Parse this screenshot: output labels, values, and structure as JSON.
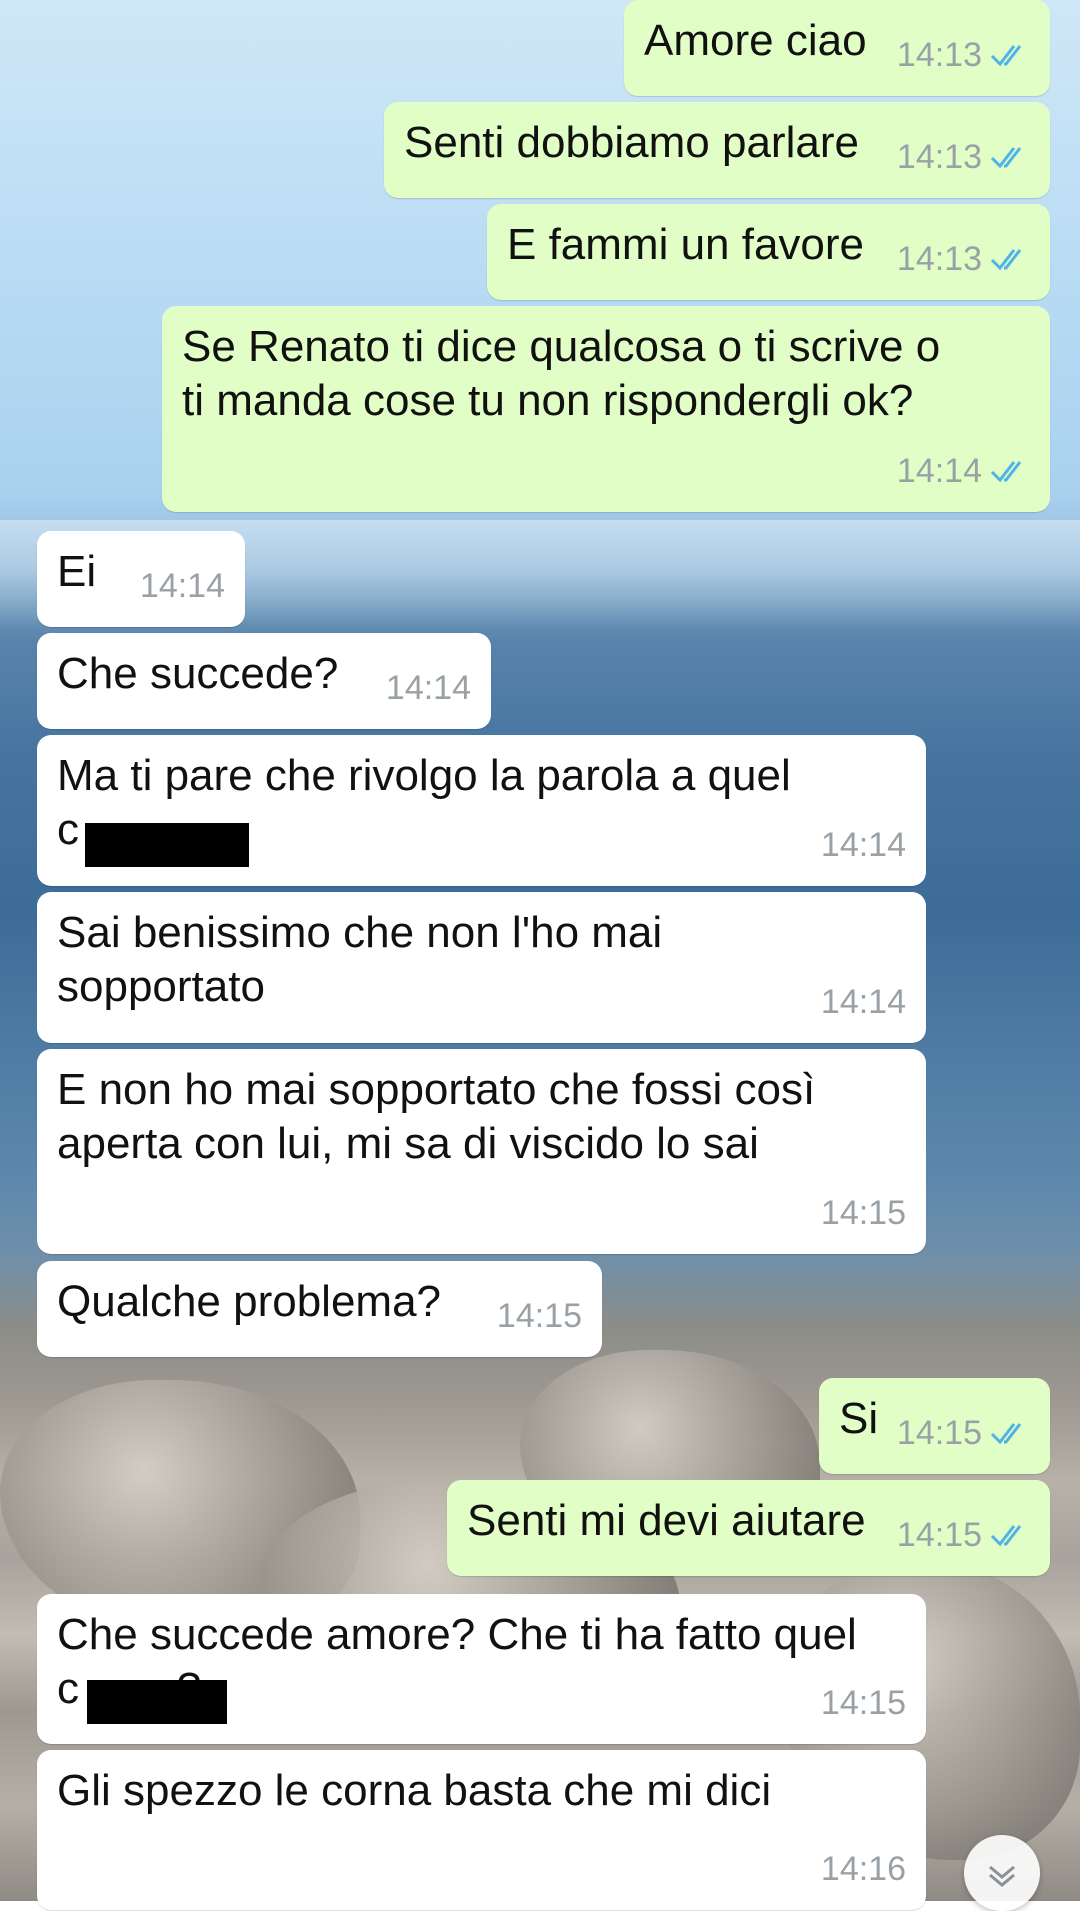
{
  "messages": [
    {
      "text": "Amore ciao",
      "time": "14:13"
    },
    {
      "text": "Senti dobbiamo parlare",
      "time": "14:13"
    },
    {
      "text": "E fammi un favore",
      "time": "14:13"
    },
    {
      "text": "Se Renato ti dice qualcosa o ti scrive o\nti manda cose tu non rispondergli ok?",
      "time": "14:14"
    },
    {
      "text": "Ei",
      "time": "14:14"
    },
    {
      "text": "Che succede?",
      "time": "14:14"
    },
    {
      "text": "Ma ti pare che rivolgo la parola a quel\nc",
      "time": "14:14"
    },
    {
      "text": "Sai benissimo che non l'ho mai\nsopportato",
      "time": "14:14"
    },
    {
      "text": "E non ho mai sopportato che fossi così\naperta con lui, mi sa di viscido lo sai",
      "time": "14:15"
    },
    {
      "text": "Qualche problema?",
      "time": "14:15"
    },
    {
      "text": "Si",
      "time": "14:15"
    },
    {
      "text": "Senti mi devi aiutare",
      "time": "14:15"
    },
    {
      "text": "Che succede amore? Che ti ha fatto quel\nc        ?",
      "time": "14:15"
    },
    {
      "text": "Gli spezzo le corna basta che mi dici",
      "time": "14:16"
    }
  ],
  "icons": {
    "read_receipt": "double-check-icon",
    "scroll_down": "chevron-down-icon"
  },
  "colors": {
    "outgoing_bubble": "#e1fec6",
    "incoming_bubble": "#ffffff",
    "read_tick": "#4fb3e8",
    "time_text": "#9aa1a6"
  }
}
